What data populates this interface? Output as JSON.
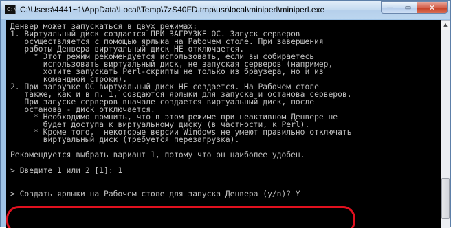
{
  "window": {
    "title": "C:\\Users\\4441~1\\AppData\\Local\\Temp\\7zS40FD.tmp\\usr\\local\\miniperl\\miniperl.exe",
    "icon": "console-app-icon",
    "controls": {
      "minimize": "—",
      "maximize": "▭",
      "close": "✕"
    }
  },
  "console": {
    "lines": [
      "Денвер может запускаться в двух режимах:",
      "1. Виртуальный диск создается ПРИ ЗАГРУЗКЕ ОС. Запуск серверов",
      "   осуществляется с помощью ярлыка на Рабочем столе. При завершения",
      "   работы Денвера виртуальный диск НЕ отключается.",
      "     * Этот режим рекомендуется использовать, если вы собираетесь",
      "       использовать виртуальный диск, не запуская серверов (например,",
      "       хотите запускать Perl-скрипты не только из браузера, но и из",
      "       командной строки).",
      "2. При загрузке ОС виртуальный диск НЕ создается. На Рабочем столе",
      "   также, как и в п. 1, создаются ярлыки для запуска и останова серверов.",
      "   При запуске серверов вначале создается виртуальный диск, после",
      "   останова - диск отключается.",
      "     * Необходимо помнить, что в этом режиме при неактивном Денвере не",
      "       будет доступа к виртуальному диску (в частности, к Perl).",
      "     * Кроме того,  некоторые версии Windows не умеют правильно отключать",
      "       виртуальный диск (требуется перезагрузка).",
      "",
      "Рекомендуется выбрать вариант 1, потому что он наиболее удобен.",
      "",
      "> Введите 1 или 2 [1]: 1",
      "",
      "> Создать ярлыки на Рабочем столе для запуска Денвера (y/n)? Y"
    ]
  },
  "highlight": {
    "color": "#e0101e"
  }
}
